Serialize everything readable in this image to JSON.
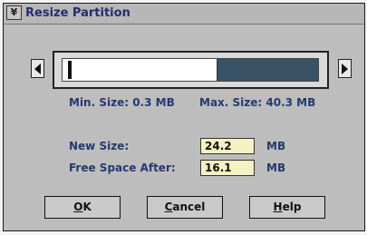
{
  "window": {
    "title": "Resize Partition",
    "sysmenu_icon": "¥"
  },
  "slider": {
    "fill_fraction": 0.6
  },
  "info": {
    "min_size": "Min. Size: 0.3 MB",
    "max_size": "Max. Size: 40.3 MB"
  },
  "fields": {
    "new_size_label": "New Size:",
    "new_size_value": "24.2",
    "new_size_unit": "MB",
    "free_space_label": "Free Space After:",
    "free_space_value": "16.1",
    "free_space_unit": "MB"
  },
  "buttons": {
    "ok_mnemonic": "O",
    "ok_rest": "K",
    "cancel_mnemonic": "C",
    "cancel_rest": "ancel",
    "help_mnemonic": "H",
    "help_rest": "elp"
  },
  "colors": {
    "title_text": "#2a2a70",
    "label_text": "#243a6e",
    "free_space_fill": "#3a5266",
    "field_background": "#f5f1c2"
  }
}
